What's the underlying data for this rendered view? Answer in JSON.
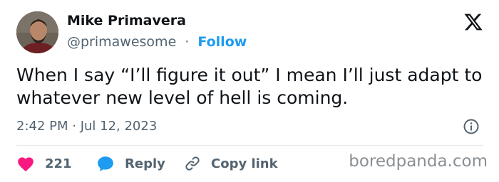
{
  "author": {
    "name": "Mike Primavera",
    "handle": "@primawesome",
    "separator": "·",
    "follow_label": "Follow"
  },
  "tweet": {
    "text": "When I say “I’ll figure it out” I mean I’ll just adapt to whatever new level of hell is coming.",
    "timestamp": "2:42 PM · Jul 12, 2023"
  },
  "actions": {
    "like_count": "221",
    "reply_label": "Reply",
    "copy_label": "Copy link"
  },
  "icons": {
    "platform": "x-logo-icon",
    "info": "info-icon",
    "like": "heart-icon",
    "reply": "speech-bubble-icon",
    "copy": "link-icon"
  },
  "colors": {
    "accent": "#1d9bf0",
    "like": "#f91880",
    "text": "#0f1419",
    "muted": "#536471"
  },
  "watermark": "boredpanda.com"
}
